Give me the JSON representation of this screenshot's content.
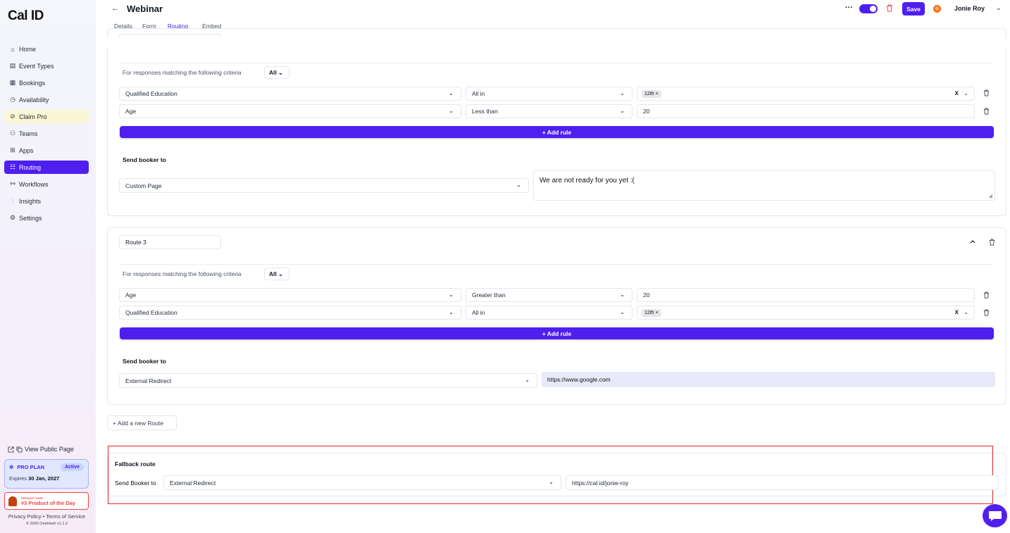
{
  "brand": {
    "logo": "Cal ID",
    "accent": "#4f1ff0"
  },
  "sidebar": {
    "items": [
      {
        "icon": "⌂",
        "label": "Home"
      },
      {
        "icon": "▤",
        "label": "Event Types"
      },
      {
        "icon": "▦",
        "label": "Bookings"
      },
      {
        "icon": "◷",
        "label": "Availability"
      },
      {
        "icon": "⊘",
        "label": "Claim Pro"
      },
      {
        "icon": "⚇",
        "label": "Teams"
      },
      {
        "icon": "⊞",
        "label": "Apps"
      },
      {
        "icon": "☷",
        "label": "Routing"
      },
      {
        "icon": "⚯",
        "label": "Workflows"
      },
      {
        "icon": "⫶",
        "label": "Insights"
      },
      {
        "icon": "⚙",
        "label": "Settings"
      }
    ],
    "view_public_page": "View Public Page",
    "plan": {
      "name": "PRO PLAN",
      "status": "Active",
      "expires_prefix": "Expires",
      "expires_date": "30 Jan, 2027"
    },
    "product_hunt": {
      "small": "PRODUCT HUNT",
      "big": "#3 Product of the Day"
    },
    "footer": {
      "privacy": "Privacy Policy",
      "sep": "•",
      "terms": "Terms of Service",
      "copyright": "© 2026 OneHash v1.1.2"
    }
  },
  "header": {
    "back": "←",
    "title": "Webinar",
    "tabs": [
      "Details",
      "Form",
      "Routing",
      "Embed"
    ],
    "active_tab": "Routing",
    "more": "···",
    "save": "Save",
    "avatar_initial": "G",
    "user_name": "Jonie Roy",
    "user_chevron": "⌄"
  },
  "route2": {
    "criteria_label": "For responses matching the following criteria",
    "criteria_mode": "All",
    "rules": [
      {
        "field": "Qualified Education",
        "operator": "All in",
        "value_tag": "12th ×",
        "value_text": ""
      },
      {
        "field": "Age",
        "operator": "Less than",
        "value_tag": "",
        "value_text": "20"
      }
    ],
    "add_rule": "+ Add rule",
    "send_label": "Send booker to",
    "send_type": "Custom Page",
    "send_value": "We are not ready for you yet :("
  },
  "route3": {
    "name": "Route 3",
    "criteria_label": "For responses matching the following criteria",
    "criteria_mode": "All",
    "rules": [
      {
        "field": "Age",
        "operator": "Greater than",
        "value_tag": "",
        "value_text": "20"
      },
      {
        "field": "Qualified Education",
        "operator": "All in",
        "value_tag": "12th ×",
        "value_text": ""
      }
    ],
    "add_rule": "+ Add rule",
    "send_label": "Send booker to",
    "send_type": "External Redirect",
    "send_value": "https://www.google.com"
  },
  "add_route": "+ Add a new Route",
  "fallback": {
    "title": "Fallback route",
    "send_label": "Send Booker to",
    "send_type": "External Redirect",
    "send_value": "https://cal.id/jonie-roy"
  },
  "icons": {
    "chevron": "⌄",
    "clear": "x",
    "trash": "🗑",
    "collapse": "^"
  }
}
